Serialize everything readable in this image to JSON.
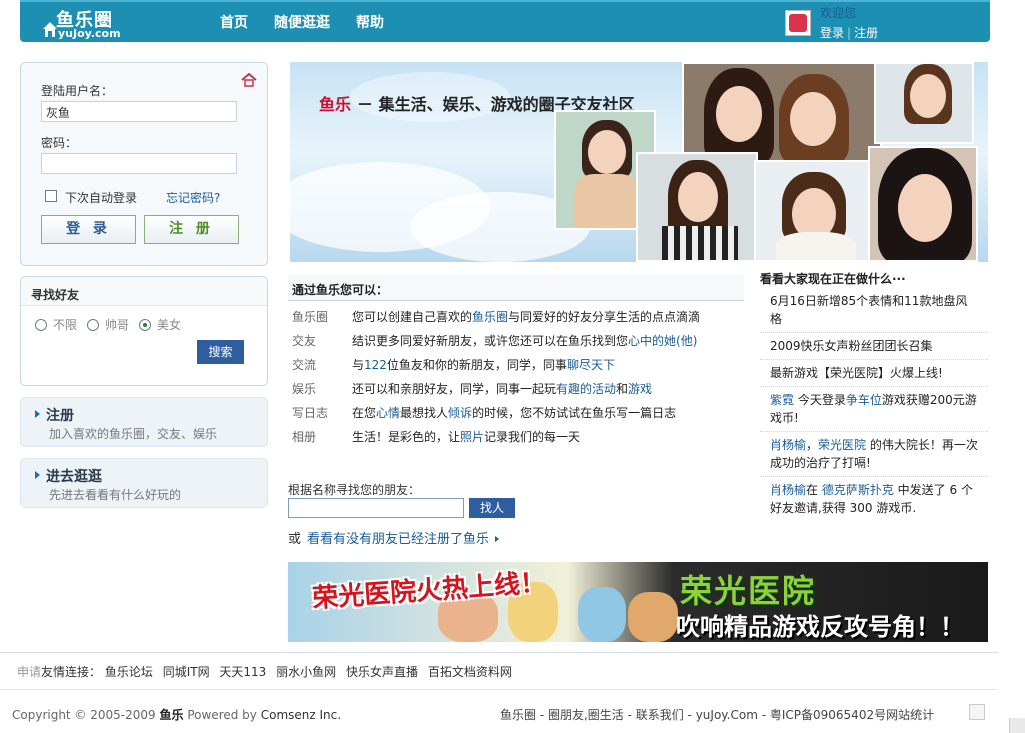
{
  "header": {
    "logo_cn": "鱼乐圈",
    "logo_en": "yuJoy.com",
    "nav": [
      "首页",
      "随便逛逛",
      "帮助"
    ],
    "welcome": "欢迎您",
    "login": "登录",
    "register": "注册"
  },
  "login": {
    "username_label": "登陆用户名：",
    "username_value": "灰鱼",
    "password_label": "密码：",
    "remember": "下次自动登录",
    "forgot": "忘记密码?",
    "login_button": "登 录",
    "register_button": "注 册"
  },
  "find_friends": {
    "title": "寻找好友",
    "options": [
      "不限",
      "帅哥",
      "美女"
    ],
    "selected": "美女",
    "search_button": "搜索"
  },
  "promos": [
    {
      "title": "注册",
      "desc": "加入喜欢的鱼乐圈，交友、娱乐"
    },
    {
      "title": "进去逛逛",
      "desc": "先进去看看有什么好玩的"
    }
  ],
  "banner": {
    "brand": "鱼乐",
    "slogan": "－ 集生活、娱乐、游戏的圈子交友社区"
  },
  "features": {
    "title": "通过鱼乐您可以：",
    "rows": [
      {
        "k": "鱼乐圈",
        "a": "您可以创建自己喜欢的",
        "h1": "鱼乐圈",
        "b": "与同爱好的好友分享生活的点点滴滴",
        "h2": "",
        "c": ""
      },
      {
        "k": "交友",
        "a": "结识更多同爱好新朋友，或许您还可以在鱼乐找到您",
        "h1": "心中的她(他)",
        "b": "",
        "h2": "",
        "c": ""
      },
      {
        "k": "交流",
        "a": "与",
        "h1": "122",
        "b": "位鱼友和你的新朋友，同学，同事",
        "h2": "聊尽天下",
        "c": ""
      },
      {
        "k": "娱乐",
        "a": "还可以和亲朋好友，同学，同事一起玩",
        "h1": "有趣的活动",
        "b": "和",
        "h2": "游戏",
        "c": ""
      },
      {
        "k": "写日志",
        "a": "在您",
        "h1": "心情",
        "b": "最想找人",
        "h2": "倾诉",
        "c": "的时候，您不妨试试在鱼乐写一篇日志"
      },
      {
        "k": "相册",
        "a": "生活！是彩色的，让",
        "h1": "照片",
        "b": "记录我们的每一天",
        "h2": "",
        "c": ""
      }
    ]
  },
  "name_search": {
    "label": "根据名称寻找您的朋友：",
    "button": "找人",
    "or": "或",
    "link": "看看有没有朋友已经注册了鱼乐"
  },
  "activity": {
    "title": "看看大家现在正在做什么···",
    "items": [
      {
        "a": "",
        "h1": "",
        "b": "6月16日新增85个表情和11款地盘风格",
        "h2": "",
        "c": ""
      },
      {
        "a": "",
        "h1": "",
        "b": "2009快乐女声粉丝团团长召集",
        "h2": "",
        "c": ""
      },
      {
        "a": "",
        "h1": "",
        "b": "最新游戏【荣光医院】火爆上线!",
        "h2": "",
        "c": ""
      },
      {
        "a": "",
        "h1": "紫霓",
        "b": " 今天登录",
        "h2": "争车位",
        "c": "游戏获赠200元游戏币!"
      },
      {
        "a": "",
        "h1": "肖杨榆",
        "b": "，",
        "h2": "荣光医院",
        "c": " 的伟大院长！再一次成功的治疗了打嗝!"
      },
      {
        "a": "",
        "h1": "肖杨榆",
        "b": "在 ",
        "h2": "德克萨斯扑克",
        "c": " 中发送了 6 个好友邀请,获得 300 游戏币."
      }
    ]
  },
  "game_banner": {
    "tagline": "荣光医院火热上线！",
    "name": "荣光医院",
    "slogan": "吹响精品游戏反攻号角！！"
  },
  "friend_links": {
    "apply": "申请",
    "title": "友情连接：",
    "links": [
      "鱼乐论坛",
      "同城IT网",
      "天天113",
      "丽水小鱼网",
      "快乐女声直播",
      "百拓文档资料网"
    ]
  },
  "footer": {
    "copyright": "Copyright © 2005-2009",
    "brand": "鱼乐",
    "powered": "Powered by",
    "corp": "Comsenz Inc.",
    "right": "鱼乐圈 - 圈朋友,圈生活 - 联系我们 - yuJoy.Com - 粤ICP备09065402号网站统计"
  },
  "colors": {
    "header": "#1d8fb2",
    "link": "#1a5c96",
    "button": "#2f5ea0",
    "brand_red": "#c8102e"
  }
}
